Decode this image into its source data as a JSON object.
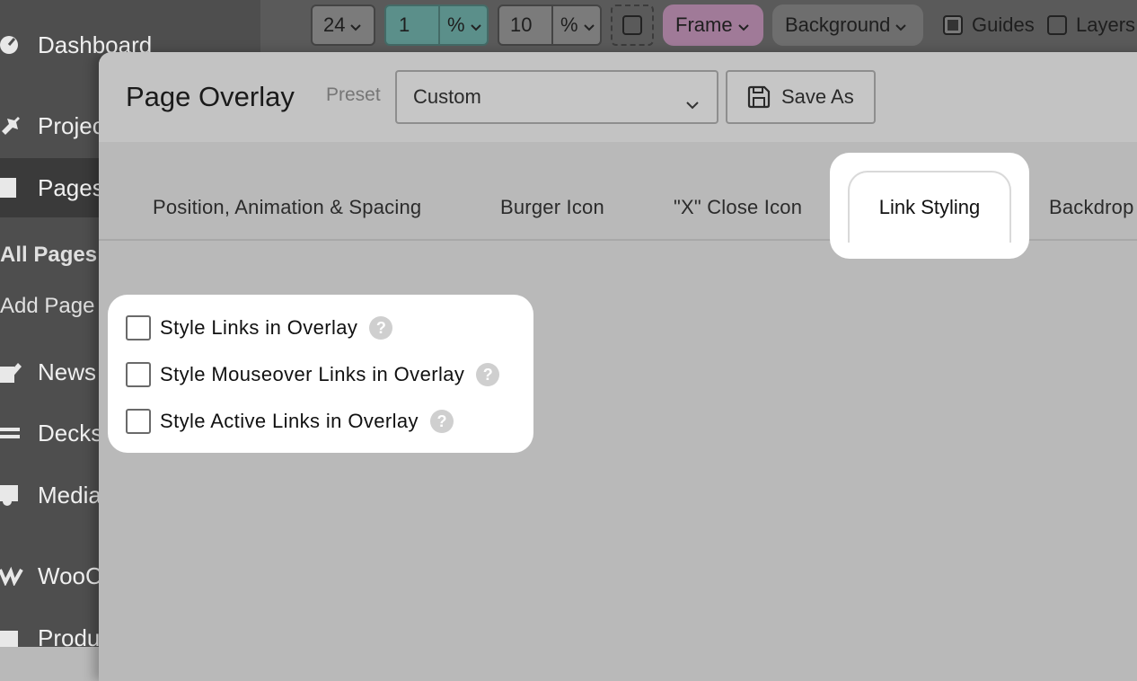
{
  "sidebar": {
    "items": [
      {
        "label": "Dashboard",
        "icon": "dashboard-icon"
      },
      {
        "label": "Projects",
        "icon": "pin-icon"
      },
      {
        "label": "Pages",
        "icon": "pages-icon"
      },
      {
        "label": "News",
        "icon": "edit-icon"
      },
      {
        "label": "Decks",
        "icon": "deck-icon"
      },
      {
        "label": "Media",
        "icon": "media-icon"
      },
      {
        "label": "WooCommerce",
        "icon": "woo-icon"
      },
      {
        "label": "Products",
        "icon": "products-icon"
      }
    ],
    "submenu": [
      {
        "label": "All Pages"
      },
      {
        "label": "Add Page"
      }
    ]
  },
  "toolbar": {
    "size_value": "24",
    "width_value": "1",
    "width_unit": "%",
    "gap_value": "10",
    "gap_unit": "%",
    "frame_label": "Frame",
    "background_label": "Background",
    "guides_label": "Guides",
    "layers_label": "Layers"
  },
  "modal": {
    "title": "Page Overlay",
    "preset_label": "Preset",
    "preset_value": "Custom",
    "save_as_label": "Save As",
    "tabs": [
      {
        "label": "Position, Animation & Spacing"
      },
      {
        "label": "Burger Icon"
      },
      {
        "label": "\"X\" Close Icon"
      },
      {
        "label": "Link Styling"
      },
      {
        "label": "Backdrop"
      }
    ],
    "active_tab": "Link Styling",
    "options": [
      {
        "label": "Style Links in Overlay",
        "checked": false,
        "help": "?"
      },
      {
        "label": "Style Mouseover Links in Overlay",
        "checked": false,
        "help": "?"
      },
      {
        "label": "Style Active Links in Overlay",
        "checked": false,
        "help": "?"
      }
    ]
  }
}
